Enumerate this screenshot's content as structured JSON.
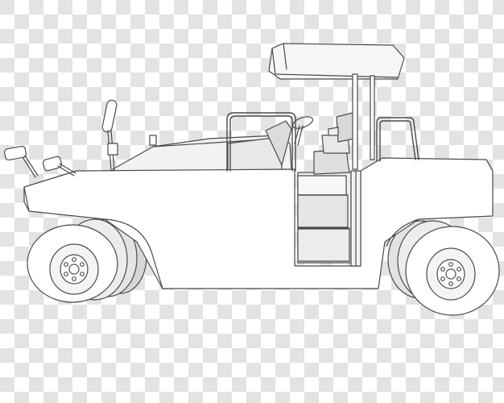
{
  "image": {
    "subject": "pneumatic-tire-road-roller",
    "background_pattern": "transparency-checkerboard",
    "colors": {
      "checker_light": "#ffffff",
      "checker_dark": "#e3e3e3",
      "outline": "#4a4a4a",
      "body_fill": "#ffffff",
      "panel_fill": "#f2f2f2",
      "shadow_fill": "#dcdcdc",
      "canopy_fill": "#f6f6f6"
    }
  }
}
